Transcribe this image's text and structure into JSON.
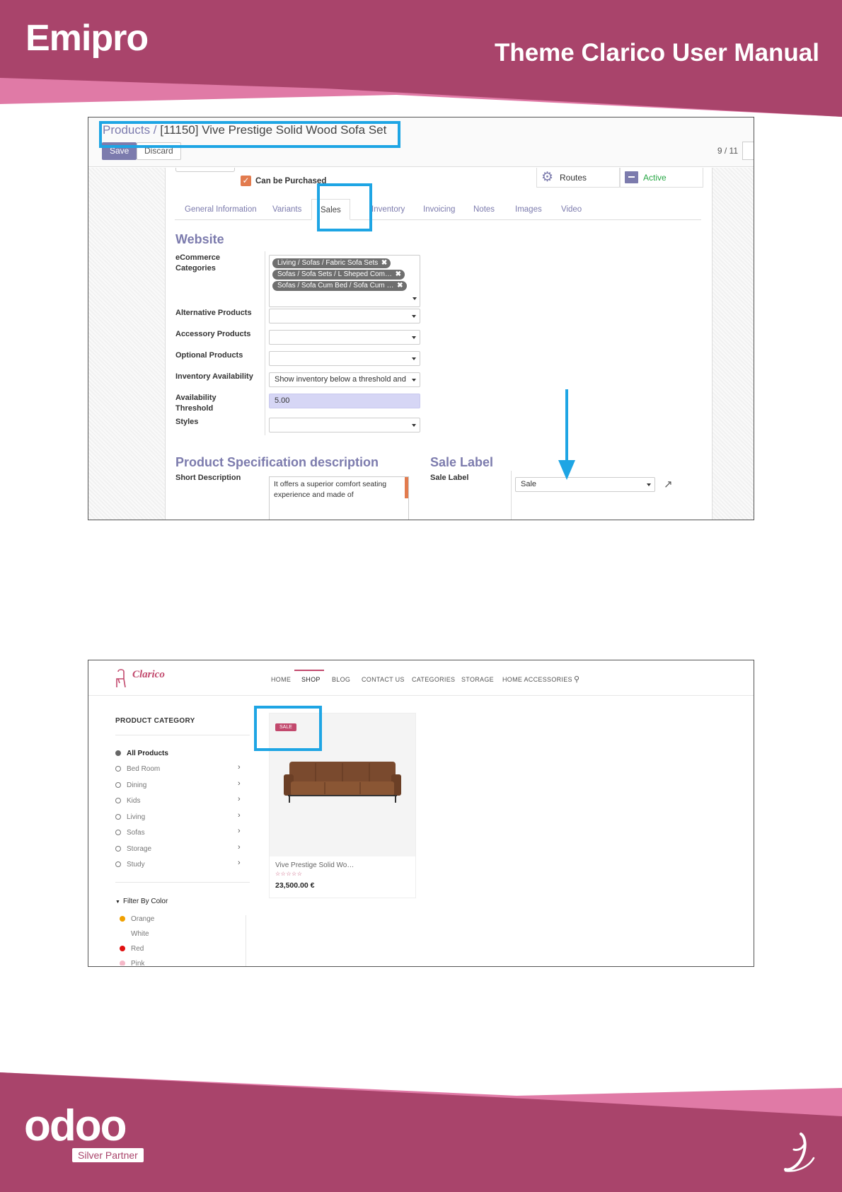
{
  "page": {
    "brand": "Emipro",
    "manual_title": "Theme Clarico User Manual",
    "footer_logo": "odoo",
    "partner_badge": "Silver Partner",
    "colors": {
      "band": "#a9446b",
      "band_light": "#e07aa6",
      "highlight": "#1ea5e4"
    }
  },
  "backend": {
    "breadcrumb_parent": "Products /",
    "breadcrumb_current": "[11150] Vive Prestige Solid Wood Sofa Set",
    "save_label": "Save",
    "discard_label": "Discard",
    "pager": "9 / 11",
    "can_be_purchased_label": "Can be Purchased",
    "smart_buttons": {
      "routes": "Routes",
      "active": "Active"
    },
    "tabs": [
      "General Information",
      "Variants",
      "Sales",
      "Inventory",
      "Invoicing",
      "Notes",
      "Images",
      "Video"
    ],
    "active_tab": "Sales",
    "website_section": {
      "title": "Website",
      "ecommerce_categories_label": "eCommerce Categories",
      "ecommerce_categories": [
        "Living / Sofas / Fabric Sofa Sets",
        "Sofas / Sofa Sets / L Sheped Com…",
        "Sofas / Sofa Cum Bed / Sofa Cum …"
      ],
      "alternative_products_label": "Alternative Products",
      "accessory_products_label": "Accessory Products",
      "optional_products_label": "Optional Products",
      "inventory_availability_label": "Inventory Availability",
      "inventory_availability_value": "Show inventory below a threshold and",
      "availability_threshold_label": "Availability Threshold",
      "availability_threshold_value": "5.00",
      "styles_label": "Styles"
    },
    "spec_section": {
      "title": "Product Specification description",
      "short_description_label": "Short Description",
      "short_description_value": "It offers a superior comfort seating experience and made of"
    },
    "sale_label_section": {
      "title": "Sale Label",
      "field_label": "Sale Label",
      "value": "Sale"
    }
  },
  "shop": {
    "logo": "Clarico",
    "nav": [
      "HOME",
      "SHOP",
      "BLOG",
      "CONTACT US",
      "CATEGORIES",
      "STORAGE",
      "HOME ACCESSORIES"
    ],
    "active_nav": "SHOP",
    "sidebar_title": "PRODUCT CATEGORY",
    "categories": [
      "All Products",
      "Bed Room",
      "Dining",
      "Kids",
      "Living",
      "Sofas",
      "Storage",
      "Study"
    ],
    "filter_title": "Filter By Color",
    "colors": [
      {
        "name": "Orange",
        "hex": "#f0a000"
      },
      {
        "name": "White",
        "hex": "#ffffff"
      },
      {
        "name": "Red",
        "hex": "#e01010"
      },
      {
        "name": "Pink",
        "hex": "#f5b8c8"
      }
    ],
    "product": {
      "badge": "SALE",
      "name": "Vive Prestige Solid Wo…",
      "stars": "☆☆☆☆☆",
      "price": "23,500.00 €",
      "rating": 0
    }
  }
}
